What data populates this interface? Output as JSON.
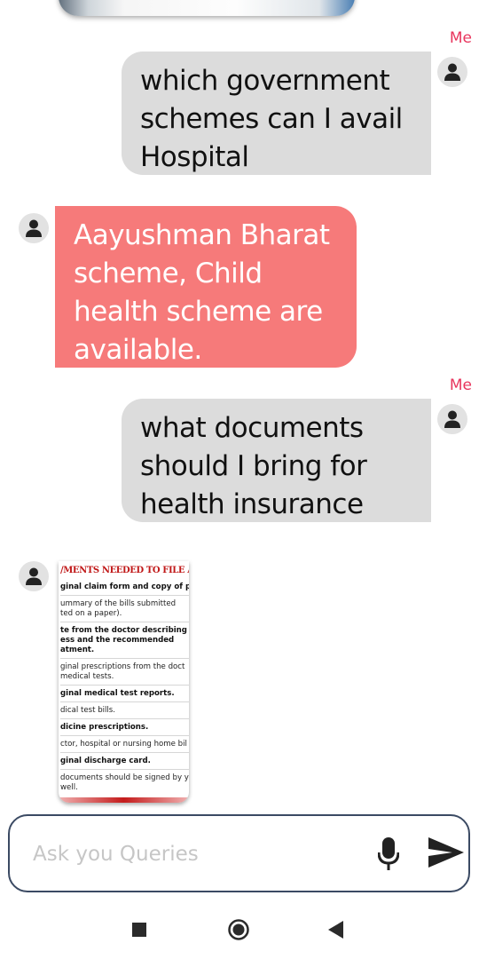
{
  "messages": [
    {
      "sender": "me",
      "label": "Me",
      "text": "which government schemes can I avail Hospital"
    },
    {
      "sender": "bot",
      "text": "Aayushman Bharat scheme, Child health scheme are available."
    },
    {
      "sender": "me",
      "label": "Me",
      "text": "what documents should I bring for health insurance"
    }
  ],
  "doc_image": {
    "title": "/MENTS NEEDED TO FILE A CL",
    "lines": [
      {
        "text": "ginal claim form and copy of pol",
        "bold": true
      },
      {
        "text": "ummary of the bills submitted",
        "bold": false
      },
      {
        "text": "ted on a paper).",
        "bold": false
      },
      {
        "text": "te from the doctor describing th",
        "bold": true
      },
      {
        "text": "ess and the recommended",
        "bold": true
      },
      {
        "text": "atment.",
        "bold": true
      },
      {
        "text": "ginal prescriptions from the doct",
        "bold": false
      },
      {
        "text": "medical tests.",
        "bold": false
      },
      {
        "text": "ginal medical test reports.",
        "bold": true
      },
      {
        "text": "dical test bills.",
        "bold": false
      },
      {
        "text": "dicine prescriptions.",
        "bold": true
      },
      {
        "text": "ctor, hospital or nursing home bil",
        "bold": false
      },
      {
        "text": "ginal discharge card.",
        "bold": true
      },
      {
        "text": "documents should be signed by y",
        "bold": false
      },
      {
        "text": "well.",
        "bold": false
      }
    ]
  },
  "input": {
    "placeholder": "Ask you Queries"
  },
  "icons": {
    "mic": "microphone-icon",
    "send": "send-icon",
    "avatar": "person-icon",
    "nav_recents": "square-icon",
    "nav_home": "circle-icon",
    "nav_back": "triangle-back-icon"
  },
  "colors": {
    "me_bubble": "#dcdcdc",
    "bot_bubble": "#f67a7a",
    "me_label": "#e8355d",
    "input_border": "#3b4a63"
  }
}
